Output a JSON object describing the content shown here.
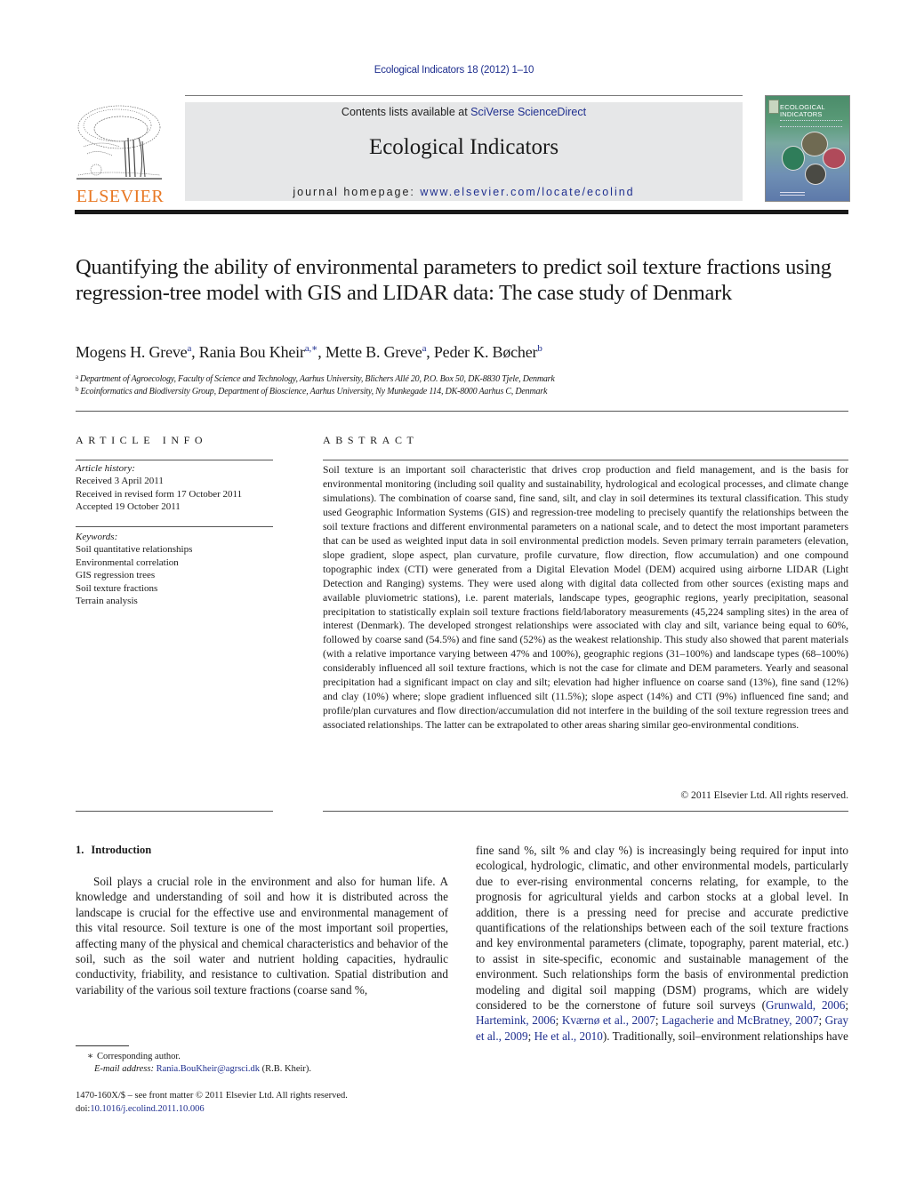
{
  "header": {
    "journal_ref": "Ecological Indicators 18 (2012) 1–10",
    "contents_prefix": "Contents lists available at ",
    "contents_link": "SciVerse ScienceDirect",
    "journal_title": "Ecological Indicators",
    "homepage_prefix": "journal homepage: ",
    "homepage_link": "www.elsevier.com/locate/ecolind",
    "publisher_logo_text": "ELSEVIER",
    "cover_title_line1": "ECOLOGICAL",
    "cover_title_line2": "INDICATORS",
    "colors": {
      "link": "#1f2f8f",
      "publisher_orange": "#e87722",
      "banner_bg": "#e6e7e8"
    }
  },
  "article": {
    "title": "Quantifying the ability of environmental parameters to predict soil texture fractions using regression-tree model with GIS and LIDAR data: The case study of Denmark",
    "authors": [
      {
        "name": "Mogens H. Greve",
        "sup": "a"
      },
      {
        "name": "Rania Bou Kheir",
        "sup": "a,∗"
      },
      {
        "name": "Mette B. Greve",
        "sup": "a"
      },
      {
        "name": "Peder K. Bøcher",
        "sup": "b"
      }
    ],
    "affiliations": [
      {
        "key": "a",
        "text": "Department of Agroecology, Faculty of Science and Technology, Aarhus University, Blichers Allé 20, P.O. Box 50, DK-8830 Tjele, Denmark"
      },
      {
        "key": "b",
        "text": "Ecoinformatics and Biodiversity Group, Department of Bioscience, Aarhus University, Ny Munkegade 114, DK-8000 Aarhus C, Denmark"
      }
    ]
  },
  "article_info": {
    "heading": "ARTICLE INFO",
    "history_label": "Article history:",
    "history": [
      "Received 3 April 2011",
      "Received in revised form 17 October 2011",
      "Accepted 19 October 2011"
    ],
    "keywords_label": "Keywords:",
    "keywords": [
      "Soil quantitative relationships",
      "Environmental correlation",
      "GIS regression trees",
      "Soil texture fractions",
      "Terrain analysis"
    ]
  },
  "abstract": {
    "heading": "ABSTRACT",
    "text": "Soil texture is an important soil characteristic that drives crop production and field management, and is the basis for environmental monitoring (including soil quality and sustainability, hydrological and ecological processes, and climate change simulations). The combination of coarse sand, fine sand, silt, and clay in soil determines its textural classification. This study used Geographic Information Systems (GIS) and regression-tree modeling to precisely quantify the relationships between the soil texture fractions and different environmental parameters on a national scale, and to detect the most important parameters that can be used as weighted input data in soil environmental prediction models. Seven primary terrain parameters (elevation, slope gradient, slope aspect, plan curvature, profile curvature, flow direction, flow accumulation) and one compound topographic index (CTI) were generated from a Digital Elevation Model (DEM) acquired using airborne LIDAR (Light Detection and Ranging) systems. They were used along with digital data collected from other sources (existing maps and available pluviometric stations), i.e. parent materials, landscape types, geographic regions, yearly precipitation, seasonal precipitation to statistically explain soil texture fractions field/laboratory measurements (45,224 sampling sites) in the area of interest (Denmark). The developed strongest relationships were associated with clay and silt, variance being equal to 60%, followed by coarse sand (54.5%) and fine sand (52%) as the weakest relationship. This study also showed that parent materials (with a relative importance varying between 47% and 100%), geographic regions (31–100%) and landscape types (68–100%) considerably influenced all soil texture fractions, which is not the case for climate and DEM parameters. Yearly and seasonal precipitation had a significant impact on clay and silt; elevation had higher influence on coarse sand (13%), fine sand (12%) and clay (10%) where; slope gradient influenced silt (11.5%); slope aspect (14%) and CTI (9%) influenced fine sand; and profile/plan curvatures and flow direction/accumulation did not interfere in the building of the soil texture regression trees and associated relationships. The latter can be extrapolated to other areas sharing similar geo-environmental conditions.",
    "copyright": "© 2011 Elsevier Ltd. All rights reserved."
  },
  "body": {
    "section_number": "1.",
    "section_title": "Introduction",
    "left_column": "Soil plays a crucial role in the environment and also for human life. A knowledge and understanding of soil and how it is distributed across the landscape is crucial for the effective use and environmental management of this vital resource. Soil texture is one of the most important soil properties, affecting many of the physical and chemical characteristics and behavior of the soil, such as the soil water and nutrient holding capacities, hydraulic conductivity, friability, and resistance to cultivation. Spatial distribution and variability of the various soil texture fractions (coarse sand %,",
    "right_column_text": "fine sand %, silt % and clay %) is increasingly being required for input into ecological, hydrologic, climatic, and other environmental models, particularly due to ever-rising environmental concerns relating, for example, to the prognosis for agricultural yields and carbon stocks at a global level. In addition, there is a pressing need for precise and accurate predictive quantifications of the relationships between each of the soil texture fractions and key environmental parameters (climate, topography, parent material, etc.) to assist in site-specific, economic and sustainable management of the environment. Such relationships form the basis of environmental prediction modeling and digital soil mapping (DSM) programs, which are widely considered to be the cornerstone of future soil surveys (",
    "citations": [
      "Grunwald, 2006",
      "Hartemink, 2006",
      "Kværnø et al., 2007",
      "Lagacherie and McBratney, 2007",
      "Gray et al., 2009",
      "He et al., 2010"
    ],
    "right_column_tail": "). Traditionally, soil–environment relationships have"
  },
  "footnotes": {
    "star": "∗",
    "corresponding": "Corresponding author.",
    "email_label": "E-mail address:",
    "email": "Rania.BouKheir@agrsci.dk",
    "email_suffix": " (R.B. Kheir).",
    "issn": "1470-160X/$ – see front matter © 2011 Elsevier Ltd. All rights reserved.",
    "doi_prefix": "doi:",
    "doi": "10.1016/j.ecolind.2011.10.006"
  }
}
